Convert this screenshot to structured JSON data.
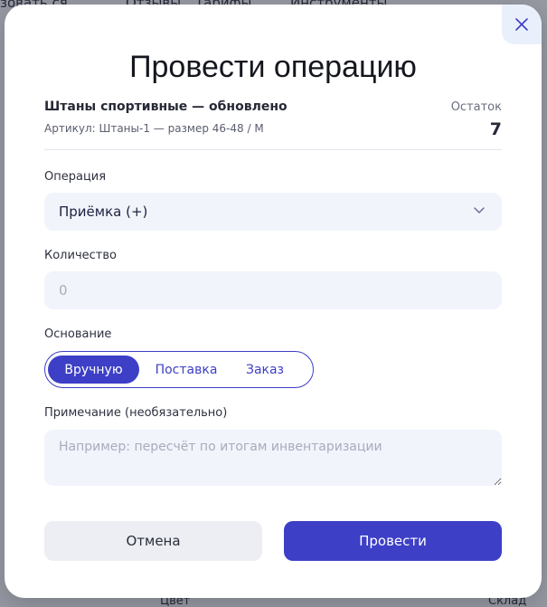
{
  "background": {
    "nav": [
      "зовать ся",
      "Отзывы",
      "Тарифы",
      "Инструменты"
    ],
    "bottom": [
      "Цвет",
      "Склад"
    ]
  },
  "modal": {
    "title": "Провести операцию",
    "product": {
      "name": "Штаны спортивные — обновлено",
      "sku": "Артикул: Штаны-1 — размер 46-48 / M",
      "stock_label": "Остаток",
      "stock_value": "7"
    },
    "operation": {
      "label": "Операция",
      "value": "Приёмка (+)"
    },
    "quantity": {
      "label": "Количество",
      "placeholder": "0"
    },
    "basis": {
      "label": "Основание",
      "options": [
        "Вручную",
        "Поставка",
        "Заказ"
      ],
      "selected": "Вручную"
    },
    "note": {
      "label": "Примечание (необязательно)",
      "placeholder": "Например: пересчёт по итогам инвентаризации"
    },
    "buttons": {
      "cancel": "Отмена",
      "submit": "Провести"
    }
  },
  "colors": {
    "accent": "#3d3fc6",
    "field_bg": "#f1f4fb"
  }
}
